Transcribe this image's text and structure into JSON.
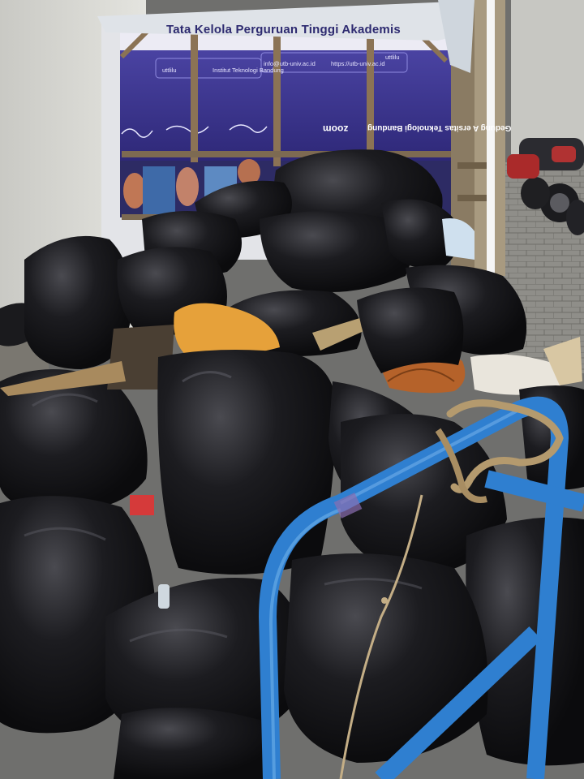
{
  "banner": {
    "title": "Tata Kelola Perguruan Tinggi Akademis",
    "contacts": [
      "uttlilu",
      "Institut Teknologi Bandung",
      "info@utb-univ.ac.id",
      "https://utb-univ.ac.id",
      "uttlilu"
    ],
    "zoom_label": "zoom",
    "building_label": "Gedung A  ersitas Teknologi Bandung"
  },
  "colors": {
    "trash_bag": "#161618",
    "cart_frame": "#2f7fd0",
    "banner_bg": "#3c3690",
    "banner_header": "#e9e8f3",
    "pavement": "#8d8c87",
    "wall": "#d9d9d4",
    "leaf": "#b5622a",
    "orange_bag": "#e6a13a"
  }
}
